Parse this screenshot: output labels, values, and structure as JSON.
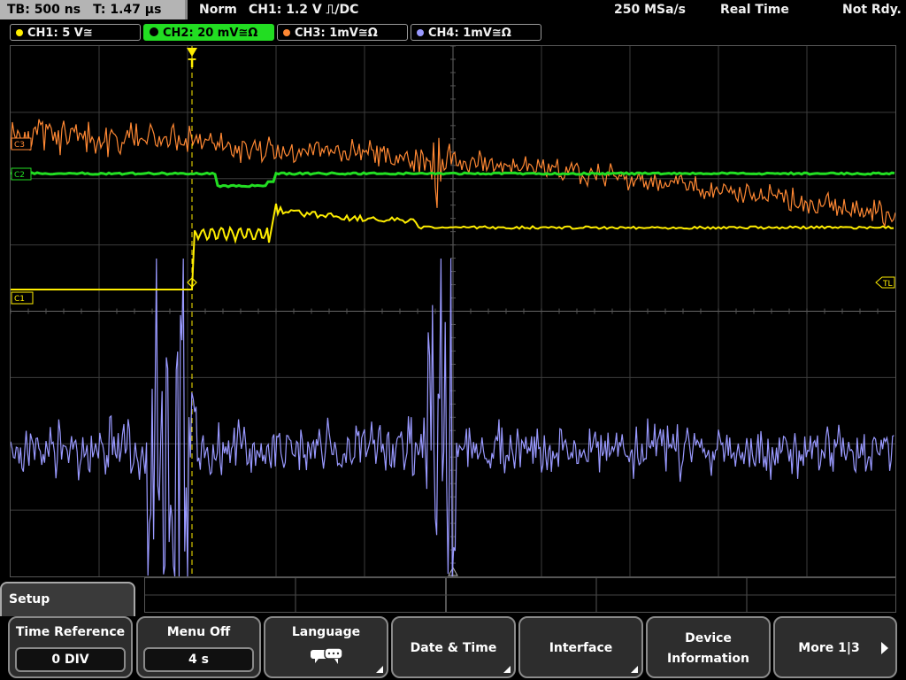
{
  "status": {
    "timebase": "TB: 500 ns",
    "trigger_time": "T: 1.47 μs",
    "mode": "Norm",
    "trigger_info": "CH1: 1.2 V ⎍/DC",
    "sample_rate": "250 MSa/s",
    "acq_mode": "Real Time",
    "state": "Not Rdy."
  },
  "channels": [
    {
      "label": "CH1: 5 V≅",
      "color": "#ffee00",
      "active": false
    },
    {
      "label": "CH2: 20 mV≅Ω",
      "color": "#22dd22",
      "active": true
    },
    {
      "label": "CH3: 1mV≅Ω",
      "color": "#ff8833",
      "active": false
    },
    {
      "label": "CH4: 1mV≅Ω",
      "color": "#9999ff",
      "active": false
    }
  ],
  "screen": {
    "trigger_marker": "T",
    "trigger_level_label": "TL",
    "ch1_marker": "C1",
    "ch2_marker": "C2",
    "ch3_marker": "C3"
  },
  "menu": {
    "title": "Setup",
    "softkeys": [
      {
        "label": "Time Reference",
        "value": "0 DIV"
      },
      {
        "label": "Menu Off",
        "value": "4 s"
      },
      {
        "label": "Language",
        "icon": "speech-bubble-icon"
      },
      {
        "label": "Date & Time"
      },
      {
        "label": "Interface"
      },
      {
        "label": "Device",
        "label2": "Information"
      },
      {
        "label": "More 1|3"
      }
    ]
  },
  "colors": {
    "ch1": "#ffee00",
    "ch2": "#22dd22",
    "ch3": "#ff8833",
    "ch4": "#9999ff",
    "grid": "#555555"
  }
}
